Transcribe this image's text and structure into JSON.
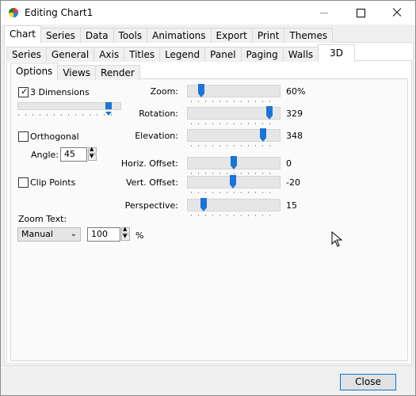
{
  "window": {
    "title": "Editing Chart1"
  },
  "tabs_main": [
    "Chart",
    "Series",
    "Data",
    "Tools",
    "Animations",
    "Export",
    "Print",
    "Themes"
  ],
  "tabs_chart": [
    "Series",
    "General",
    "Axis",
    "Titles",
    "Legend",
    "Panel",
    "Paging",
    "Walls",
    "3D"
  ],
  "tabs_3d": [
    "Options",
    "Views",
    "Render"
  ],
  "three_d": {
    "label": "3 Dimensions",
    "checked": true,
    "level_pct": 92
  },
  "orthogonal": {
    "label": "Orthogonal",
    "checked": false,
    "angle_label": "Angle:",
    "angle_value": "45"
  },
  "clip_points": {
    "label": "Clip Points",
    "checked": false
  },
  "zoom_text": {
    "label": "Zoom Text:",
    "mode": "Manual",
    "value": "100",
    "unit": "%"
  },
  "sliders": [
    {
      "label": "Zoom:",
      "value": "60%",
      "level_pct": 12
    },
    {
      "label": "Rotation:",
      "value": "329",
      "level_pct": 92
    },
    {
      "label": "Elevation:",
      "value": "348",
      "level_pct": 84
    },
    {
      "label": "Horiz. Offset:",
      "value": "0",
      "level_pct": 50
    },
    {
      "label": "Vert. Offset:",
      "value": "-20",
      "level_pct": 49
    },
    {
      "label": "Perspective:",
      "value": "15",
      "level_pct": 15
    }
  ],
  "buttons": {
    "close": "Close"
  },
  "colors": {
    "slider_thumb": "#1a74d9",
    "accent_border": "#0078d7"
  },
  "icons": {
    "app": "chart-pie-icon",
    "minimize": "minimize-icon",
    "maximize": "maximize-icon",
    "close": "close-icon",
    "dropdown": "chevron-down-icon",
    "cursor": "mouse-pointer-icon"
  }
}
